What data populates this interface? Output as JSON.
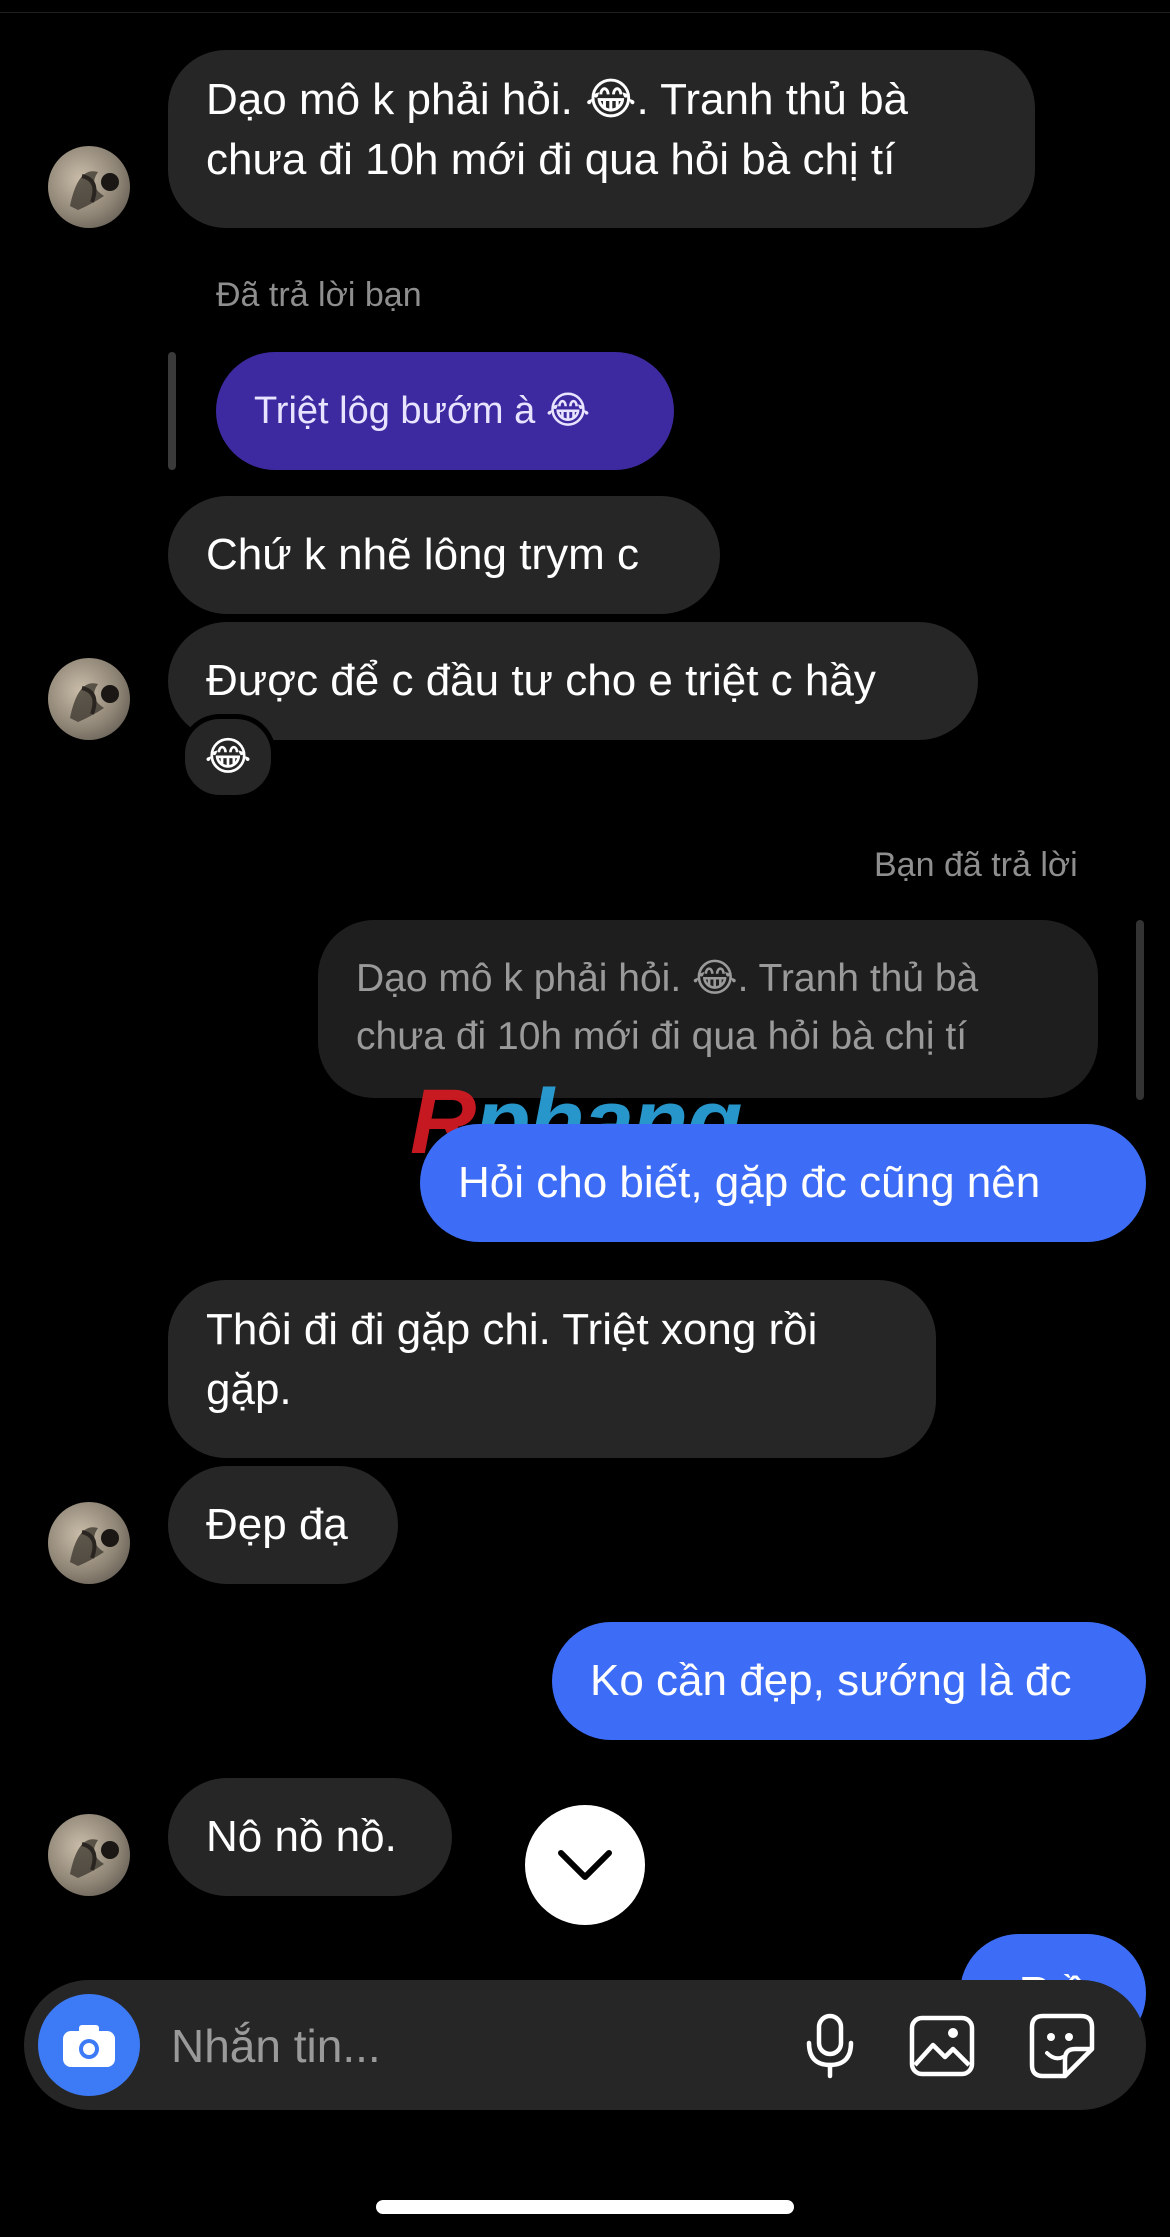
{
  "messages": {
    "m1_line1": "Dạo mô k phải hỏi. 😂. Tranh thủ bà",
    "m1_line2": "chưa đi 10h mới đi qua hỏi bà chị tí",
    "reply_label_them": "Đã trả lời bạn",
    "quoted_purple": "Triệt lôg bướm à 😂",
    "m2": "Chứ k nhẽ lông trym c",
    "m3": "Được để c đầu tư cho e triệt c hầy",
    "reaction": "😂",
    "reply_label_you": "Bạn đã trả lời",
    "quoted_gray_line1": "Dạo mô k phải hỏi. 😂. Tranh thủ bà",
    "quoted_gray_line2": "chưa đi 10h mới đi qua hỏi bà chị tí",
    "out1": "Hỏi cho biết, gặp đc cũng nên",
    "m4_line1": "Thôi đi đi gặp chi. Triệt xong rồi",
    "m4_line2": "gặp.",
    "m5": "Đẹp đạ",
    "out2": "Ko cần đẹp, sướng là đc",
    "m6": "Nô nồ nồ.",
    "out3_partial": "R ồ"
  },
  "watermark": {
    "first": "R",
    "rest": "phang"
  },
  "composer": {
    "placeholder": "Nhắn tin..."
  },
  "colors": {
    "incoming_bubble": "#262626",
    "outgoing_bubble": "#3d6df6",
    "quoted_purple": "#3e2aa0",
    "camera_button": "#3d7bf6"
  },
  "icons": [
    "camera-icon",
    "microphone-icon",
    "gallery-icon",
    "sticker-icon",
    "chevron-down-icon"
  ]
}
